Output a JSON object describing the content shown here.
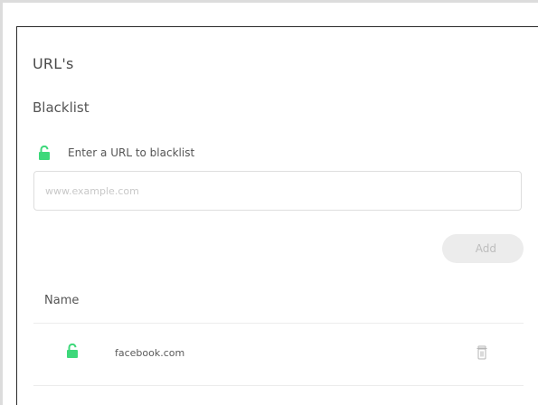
{
  "section": {
    "title": "URL's",
    "subtitle": "Blacklist"
  },
  "form": {
    "lock_label": "Enter a URL to blacklist",
    "input_placeholder": "www.example.com",
    "input_value": "",
    "add_label": "Add"
  },
  "table": {
    "columns": [
      "Name"
    ],
    "rows": [
      {
        "domain": "facebook.com",
        "lock_icon": "unlocked-padlock-icon",
        "delete_icon": "trash-icon"
      }
    ]
  },
  "colors": {
    "lock_green": "#3dd87a",
    "add_button_bg": "#ececec",
    "add_button_text": "#bdbdbd"
  }
}
